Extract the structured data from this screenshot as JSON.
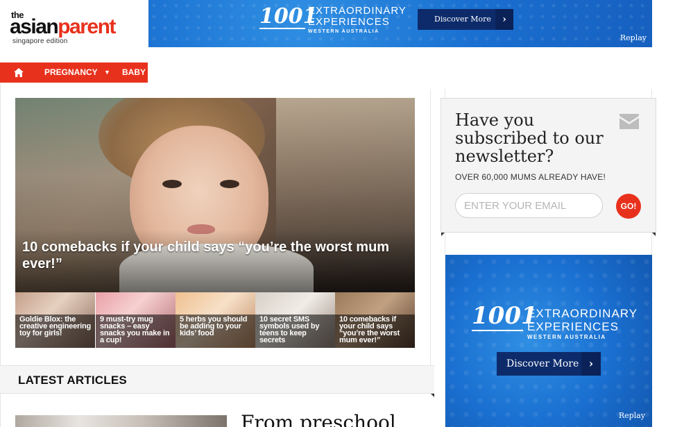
{
  "logo": {
    "line1": "the",
    "line2_dark": "asian",
    "line2_red": "parent",
    "line3": "singapore edition"
  },
  "banner_top": {
    "brand": "1001",
    "line1": "EXTRAORDINARY",
    "line2": "EXPERIENCES",
    "line3": "WESTERN AUSTRALIA",
    "cta": "Discover More",
    "replay": "Replay"
  },
  "nav": {
    "home_icon": "home-icon",
    "items": [
      {
        "label": "PREGNANCY",
        "has_dropdown": true
      },
      {
        "label": "BABY",
        "has_dropdown": false
      }
    ]
  },
  "hero": {
    "headline": "10 comebacks if your child says “you’re the worst mum ever!”"
  },
  "thumbnails": [
    {
      "caption": "Goldie Blox: the creative engineering toy for girls!"
    },
    {
      "caption": "9 must-try mug snacks – easy snacks you make in a cup!"
    },
    {
      "caption": "5 herbs you should be adding to your kids’ food"
    },
    {
      "caption": "10 secret SMS symbols used by teens to keep secrets"
    },
    {
      "caption": "10 comebacks if your child says “you’re the worst mum ever!”"
    }
  ],
  "latest": {
    "heading": "LATEST ARTICLES",
    "first_article_title": "From preschool"
  },
  "newsletter": {
    "title": "Have you subscribed to our newsletter?",
    "subtitle": "OVER 60,000 MUMS ALREADY HAVE!",
    "email_placeholder": "ENTER YOUR EMAIL",
    "submit": "GO!",
    "icon": "mail-icon"
  },
  "banner_side": {
    "brand": "1001",
    "line1": "EXTRAORDINARY",
    "line2": "EXPERIENCES",
    "line3": "WESTERN AUSTRALIA",
    "cta": "Discover More",
    "replay": "Replay"
  },
  "colors": {
    "brand_red": "#e8311c",
    "ad_blue": "#1a6fd0",
    "ad_navy": "#0d2b6b"
  }
}
